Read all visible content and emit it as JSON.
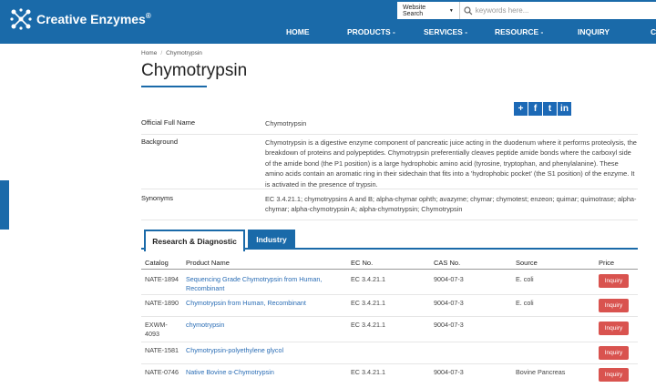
{
  "header": {
    "brand": "Creative Enzymes",
    "brand_mark": "®",
    "search": {
      "scope": "Website Search",
      "placeholder": "keywords here..."
    },
    "nav": [
      "HOME",
      "PRODUCTS -",
      "SERVICES -",
      "RESOURCE -",
      "INQUIRY",
      "C"
    ]
  },
  "breadcrumb": [
    "Home",
    "/",
    "Chymotrypsin"
  ],
  "page_title": "Chymotrypsin",
  "social": [
    "+",
    "f",
    "t",
    "in"
  ],
  "info": [
    {
      "label": "Official Full Name",
      "value": "Chymotrypsin"
    },
    {
      "label": "Background",
      "value": "Chymotrypsin is a digestive enzyme component of pancreatic juice acting in the duodenum where it performs proteolysis, the breakdown of proteins and polypeptides. Chymotrypsin preferentially cleaves peptide amide bonds where the carboxyl side of the amide bond (the P1 position) is a large hydrophobic amino acid (tyrosine, tryptophan, and phenylalanine). These amino acids contain an aromatic ring in their sidechain that fits into a 'hydrophobic pocket' (the S1 position) of the enzyme. It is activated in the presence of trypsin."
    },
    {
      "label": "Synonyms",
      "value": "EC 3.4.21.1; chymotrypsins A and B; alpha-chymar ophth; avazyme; chymar; chymotest; enzeon; quimar; quimotrase; alpha-chymar; alpha-chymotrypsin A; alpha-chymotrypsin; Chymotrypsin"
    }
  ],
  "tabs": [
    "Research & Diagnostic",
    "Industry"
  ],
  "table": {
    "headers": [
      "Catalog",
      "Product Name",
      "EC No.",
      "CAS No.",
      "Source",
      "Price"
    ],
    "rows": [
      {
        "catalog": "NATE-1894",
        "name": "Sequencing Grade Chymotrypsin from Human, Recombinant",
        "ec": "EC 3.4.21.1",
        "cas": "9004-07-3",
        "source": "E. coli",
        "price": "Inquiry"
      },
      {
        "catalog": "NATE-1890",
        "name": "Chymotrypsin from Human, Recombinant",
        "ec": "EC 3.4.21.1",
        "cas": "9004-07-3",
        "source": "E. coli",
        "price": "Inquiry"
      },
      {
        "catalog": "EXWM-4093",
        "name": "chymotrypsin",
        "ec": "EC 3.4.21.1",
        "cas": "9004-07-3",
        "source": "",
        "price": "Inquiry"
      },
      {
        "catalog": "NATE-1581",
        "name": "Chymotrypsin-polyethylene glycol",
        "ec": "",
        "cas": "",
        "source": "",
        "price": "Inquiry"
      },
      {
        "catalog": "NATE-0746",
        "name": "Native Bovine α-Chymotrypsin",
        "ec": "EC 3.4.21.1",
        "cas": "9004-07-3",
        "source": "Bovine Pancreas",
        "price": "Inquiry"
      }
    ]
  },
  "colors": {
    "brand_blue": "#1a6aa9",
    "inquiry_red": "#d9534f",
    "link_blue": "#2a6db5"
  }
}
